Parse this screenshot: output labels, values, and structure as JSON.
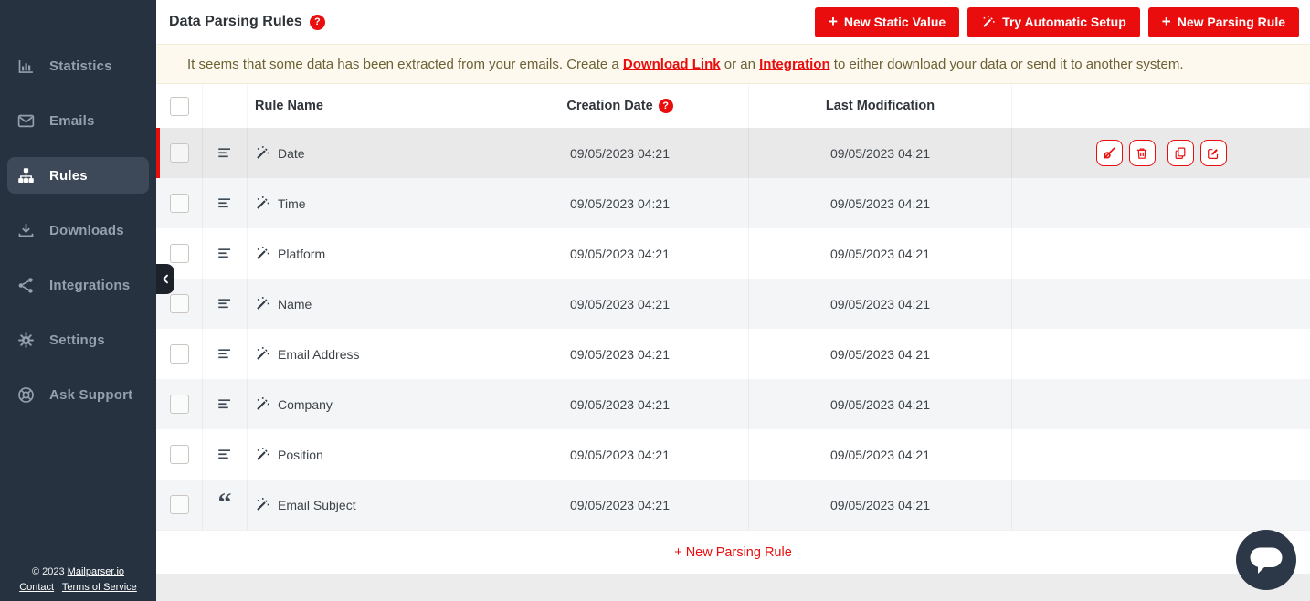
{
  "colors": {
    "accent_red": "#e90d0d",
    "sidebar_bg": "#263240",
    "sidebar_active_bg": "#3d4959",
    "notice_bg": "#fdf9ee",
    "notice_text": "#6c6135",
    "row_stripe": "#f4f5f6",
    "row_highlight": "#e9e9e9",
    "page_bg": "#ececec",
    "chat_bubble_bg": "#2c3847"
  },
  "sidebar": {
    "items": [
      {
        "label": "Statistics",
        "icon": "bar-chart"
      },
      {
        "label": "Emails",
        "icon": "envelope"
      },
      {
        "label": "Rules",
        "icon": "sitemap",
        "active": true
      },
      {
        "label": "Downloads",
        "icon": "download"
      },
      {
        "label": "Integrations",
        "icon": "share-nodes"
      },
      {
        "label": "Settings",
        "icon": "gear"
      },
      {
        "label": "Ask Support",
        "icon": "life-ring"
      }
    ],
    "footer": {
      "copyright": "© 2023 ",
      "brand": "Mailparser.io",
      "contact": "Contact",
      "divider": " | ",
      "terms": "Terms of Service"
    }
  },
  "header": {
    "title": "Data Parsing Rules",
    "help_glyph": "?",
    "buttons": {
      "static_value": {
        "plus": "+",
        "label": "New Static Value"
      },
      "auto_setup": {
        "label": "Try Automatic Setup",
        "icon": "magic-wand"
      },
      "parsing_rule": {
        "plus": "+",
        "label": "New Parsing Rule"
      }
    }
  },
  "notice": {
    "before": "It seems that some data has been extracted from your emails. Create a ",
    "download_link": "Download Link",
    "middle": " or an ",
    "integration_link": "Integration",
    "after": " to either download your data or send it to another system."
  },
  "table": {
    "headers": {
      "rule_name": "Rule Name",
      "creation_date": "Creation Date",
      "creation_help_glyph": "?",
      "last_modification": "Last Modification"
    },
    "quote_glyph": "“",
    "rows": [
      {
        "name": "Date",
        "creation": "09/05/2023 04:21",
        "modified": "09/05/2023 04:21"
      },
      {
        "name": "Time",
        "creation": "09/05/2023 04:21",
        "modified": "09/05/2023 04:21"
      },
      {
        "name": "Platform",
        "creation": "09/05/2023 04:21",
        "modified": "09/05/2023 04:21"
      },
      {
        "name": "Name",
        "creation": "09/05/2023 04:21",
        "modified": "09/05/2023 04:21"
      },
      {
        "name": "Email Address",
        "creation": "09/05/2023 04:21",
        "modified": "09/05/2023 04:21"
      },
      {
        "name": "Company",
        "creation": "09/05/2023 04:21",
        "modified": "09/05/2023 04:21"
      },
      {
        "name": "Position",
        "creation": "09/05/2023 04:21",
        "modified": "09/05/2023 04:21"
      },
      {
        "name": "Email Subject",
        "creation": "09/05/2023 04:21",
        "modified": "09/05/2023 04:21"
      }
    ],
    "row_actions": [
      "unassign",
      "delete",
      "duplicate",
      "edit"
    ],
    "add_link": "+ New Parsing Rule"
  }
}
